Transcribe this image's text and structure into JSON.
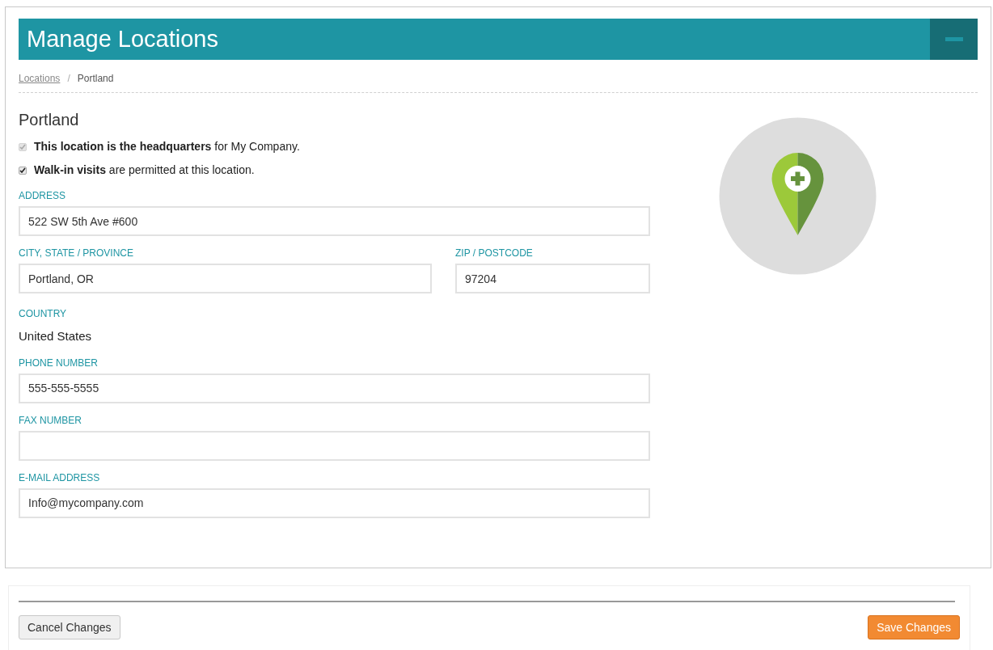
{
  "header": {
    "title": "Manage Locations"
  },
  "breadcrumb": [
    {
      "label": "Locations",
      "kind": "link"
    },
    {
      "label": "/",
      "kind": "separator"
    },
    {
      "label": "Portland",
      "kind": "current"
    }
  ],
  "location": {
    "name": "Portland"
  },
  "options": [
    {
      "text": "**This location is the headquarters** for My Company.",
      "checked": true,
      "disabled": true
    },
    {
      "text": "**Walk-in visits** are permitted at this location.",
      "checked": true,
      "disabled": false
    }
  ],
  "fields": [
    {
      "kind": "input",
      "label": "ADDRESS",
      "value": "522 SW 5th Ave #600"
    },
    {
      "kind": "pair",
      "items": [
        {
          "label": "CITY, STATE / PROVINCE",
          "value": "Portland, OR"
        },
        {
          "label": "ZIP / POSTCODE",
          "value": "97204"
        }
      ]
    },
    {
      "kind": "static",
      "label": "COUNTRY",
      "value": "United States"
    },
    {
      "kind": "input",
      "label": "PHONE NUMBER",
      "value": "555-555-5555"
    },
    {
      "kind": "input",
      "label": "FAX NUMBER"
    },
    {
      "kind": "input",
      "label": "E-MAIL ADDRESS",
      "value": "Info@mycompany.com"
    }
  ],
  "footer": {
    "cancel": "Cancel Changes",
    "save": "Save Changes"
  }
}
